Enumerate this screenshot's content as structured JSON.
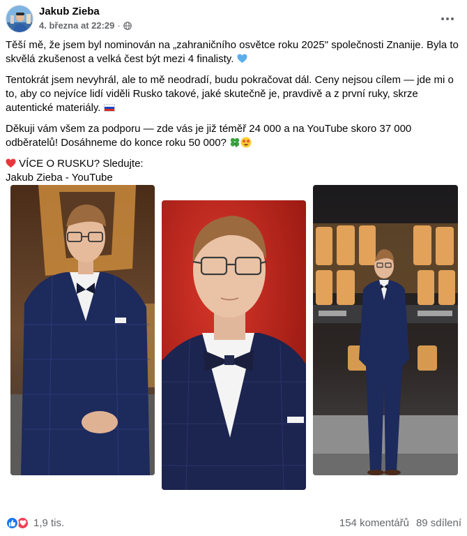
{
  "post": {
    "author": "Jakub Zieba",
    "date": "4. března at 22:29",
    "separator": "·",
    "audience_icon": "globe-icon",
    "menu_icon": "more-options-icon"
  },
  "content": {
    "p1": "Těší mě, že jsem byl nominován na „zahraničního osvětce roku 2025\" společnosti Znanije. Byla to skvělá zkušenost a velká čest být mezi 4 finalisty.",
    "p1_emoji": "blue-heart-icon",
    "p2": "Tentokrát jsem nevyhrál, ale to mě neodradí, budu pokračovat dál. Ceny nejsou cílem — jde mi o to, aby co nejvíce lidí viděli Rusko takové, jaké skutečně je, pravdivě a z první ruky, skrze autentické materiály.",
    "p2_emoji": "russia-flag-icon",
    "p3": "Děkuji vám všem za podporu — zde vás je již téměř 24 000 a na YouTube skoro 37 000 odběratelů! Dosáhneme do konce roku 50 000?",
    "p3_emojis": [
      "four-leaf-clover-icon",
      "star-struck-icon"
    ],
    "p4_heart": "red-heart-icon",
    "p4": "VÍCE O RUSKU? Sledujte:",
    "p5": "Jakub Zieba - YouTube"
  },
  "photos": [
    {
      "name": "photo-left",
      "subject": "man in navy checked suit with bow tie, gold stage letters behind"
    },
    {
      "name": "photo-center",
      "subject": "close-up of man with glasses and bow tie, red background"
    },
    {
      "name": "photo-right",
      "subject": "full-length man in navy suit in front of Znanie Premia stage sign"
    }
  ],
  "footer": {
    "reaction_icons": [
      "like-icon",
      "love-icon"
    ],
    "reaction_count": "1,9 tis.",
    "comments": "154 komentářů",
    "shares": "89 sdílení"
  },
  "colors": {
    "text": "#050505",
    "secondary": "#65676b",
    "like_blue": "#1877f2",
    "love_red": "#f33e58",
    "suit_navy": "#1d2a5c",
    "stage_gold": "#c98a3c",
    "backdrop_red": "#c4261c"
  }
}
